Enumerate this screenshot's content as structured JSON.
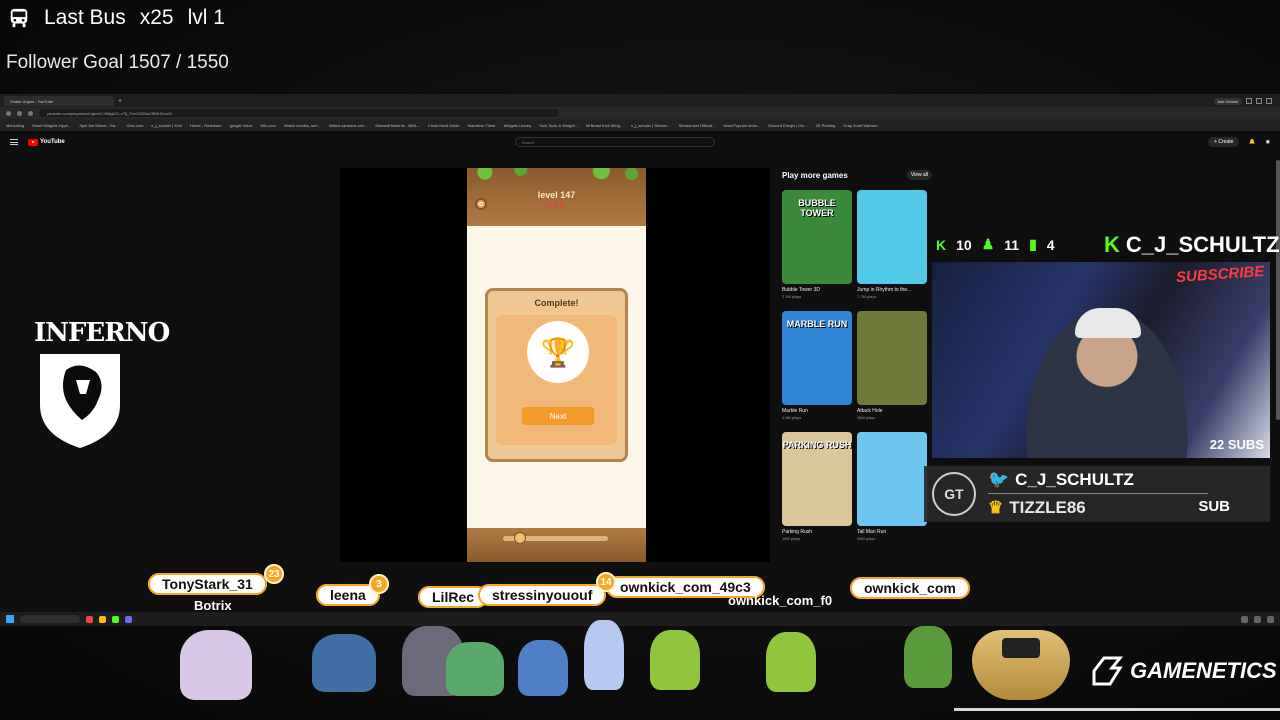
{
  "stream_overlay": {
    "last_bus_label": "Last Bus",
    "multiplier": "x25",
    "level": "lvl 1",
    "follower_goal": "Follower Goal 1507 / 1550"
  },
  "browser": {
    "tab_title": "Snake Unjam - YouTube",
    "tab_plus": "+",
    "gemini_button": "Ask Gemini",
    "url": "youtube.com/playables/UgkxhCXBllgb21-nTfj_FsVrGZlBaClBKHDvuW",
    "bookmarks": [
      "Mchosting",
      "Heart Widgets Hype...",
      "Spin the Wheel - Ra...",
      "Club.com",
      "c_j_schultz | Kick",
      "Home - Restream",
      "google Voice",
      "Wix.com",
      "Watch movies, seri...",
      "Watch cartoons onli...",
      "StreamElements - NBA...",
      "Cricut Heat Guide",
      "Marathon Timer",
      "Widgets Library",
      "Kick Tools & Widget...",
      "MrBeast Kick Widg...",
      "c_j_schultz | Stream...",
      "Streamnext Official...",
      "Most Popular Anim...",
      "Discord Emojis | Dis...",
      "3D Printing",
      "Gray Zone Warfare..."
    ]
  },
  "youtube": {
    "brand": "YouTube",
    "search_placeholder": "Search",
    "create_label": "Create"
  },
  "game": {
    "level_label": "level 147",
    "hearts": "♥♥♥",
    "dialog_title": "Complete!",
    "next_label": "Next",
    "slider_value": 0.1
  },
  "more_games": {
    "title": "Play more games",
    "view_all": "View all",
    "cards": [
      {
        "name": "Bubble Tower 3D",
        "plays": "2.1M plays",
        "thumb_text": "BUBBLE TOWER",
        "color": "#3a8a3a"
      },
      {
        "name": "Jump in Rhythm to the...",
        "plays": "7.2M plays",
        "thumb_text": "",
        "color": "#52c9e6"
      },
      {
        "name": "Marble Run",
        "plays": "4.3M plays",
        "thumb_text": "MARBLE RUN",
        "color": "#2f84d6"
      },
      {
        "name": "Attack Hole",
        "plays": "18M plays",
        "thumb_text": "",
        "color": "#6d7a3a"
      },
      {
        "name": "Parking Rush",
        "plays": "18M plays",
        "thumb_text": "PARKING RUSH",
        "color": "#d9c69a"
      },
      {
        "name": "Tall Man Run",
        "plays": "26M plays",
        "thumb_text": "",
        "color": "#6dc6ef"
      }
    ]
  },
  "webcam": {
    "kick_count": "10",
    "followers_count": "11",
    "viewers_count": "4",
    "channel_name": "C_J_SCHULTZ",
    "subscribe_text": "SUBSCRIBE",
    "subs_count": "22 SUBS"
  },
  "alert": {
    "logo_text": "GT",
    "twitter_handle": "C_J_SCHULTZ",
    "latest_sub": "TIZZLE86",
    "sub_label": "SUB"
  },
  "left_logo": {
    "text": "INFERNO"
  },
  "chat": [
    {
      "name": "TonyStark_31",
      "level": "23"
    },
    {
      "name": "leena",
      "level": "3"
    },
    {
      "name": "LilRec",
      "level": ""
    },
    {
      "name": "stressinyououf",
      "level": ""
    },
    {
      "name": "ownkick_com_49c3",
      "level": "14"
    },
    {
      "name": "ownkick_com",
      "level": ""
    },
    {
      "name": "Botrix",
      "level": ""
    },
    {
      "name": "ownkick_com_f0",
      "level": ""
    }
  ],
  "brand": {
    "name": "GAMENETICS"
  },
  "colors": {
    "kick_green": "#53fc18",
    "bubble_accent": "#f5a623",
    "youtube_red": "#ff0000"
  }
}
